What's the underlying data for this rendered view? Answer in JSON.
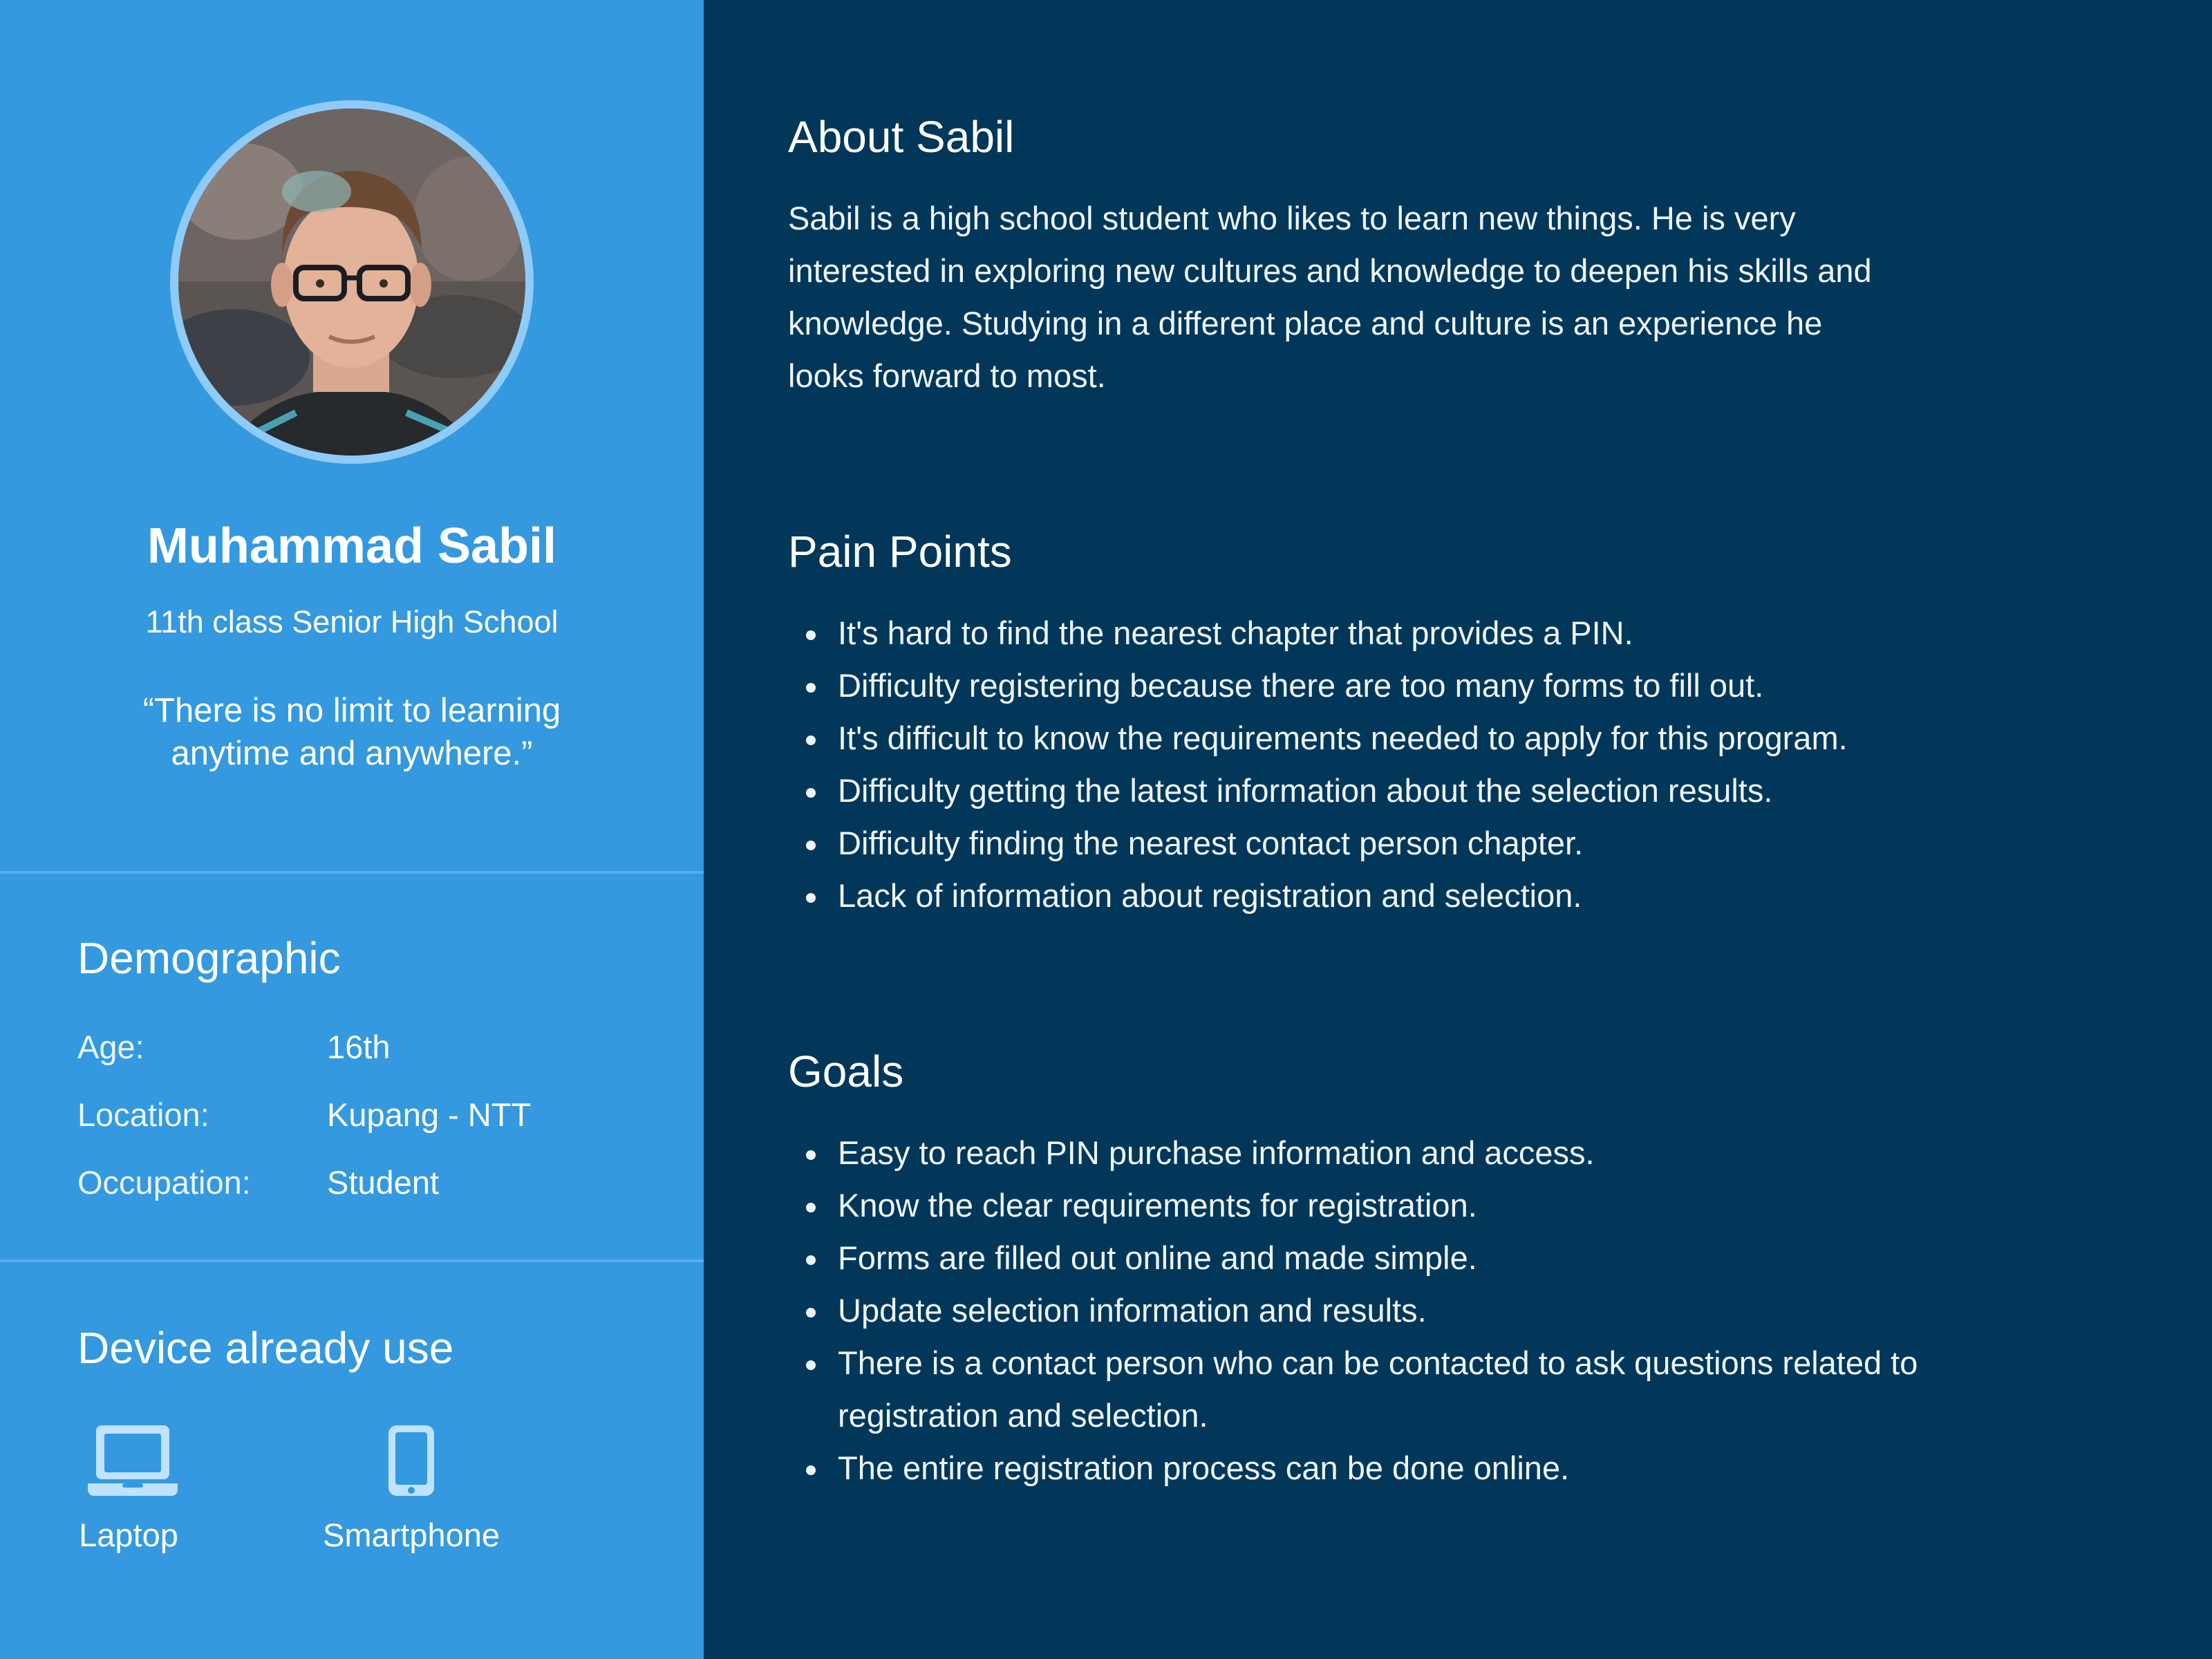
{
  "profile": {
    "name": "Muhammad Sabil",
    "subtitle": "11th class Senior High School",
    "quote_line1": "“There is no limit to learning",
    "quote_line2": "anytime and anywhere.”"
  },
  "demographic": {
    "title": "Demographic",
    "rows": [
      {
        "label": "Age:",
        "value": "16th"
      },
      {
        "label": "Location:",
        "value": "Kupang - NTT"
      },
      {
        "label": "Occupation:",
        "value": "Student"
      }
    ]
  },
  "devices": {
    "title": "Device already use",
    "items": [
      {
        "label": "Laptop",
        "icon": "laptop-icon"
      },
      {
        "label": "Smartphone",
        "icon": "smartphone-icon"
      }
    ]
  },
  "about": {
    "title": "About Sabil",
    "lines": [
      "Sabil is a high school student who likes to learn new things. He is very",
      "interested in exploring new cultures and knowledge to deepen his skills and",
      "knowledge. Studying in a different place and culture is an experience he",
      "looks forward to most."
    ]
  },
  "pain_points": {
    "title": "Pain Points",
    "items": [
      "It's hard to find the nearest chapter that provides a PIN.",
      "Difficulty registering because there are too many forms to fill out.",
      "It's difficult to know the requirements needed to apply for this program.",
      "Difficulty getting the latest information about the selection results.",
      "Difficulty finding the nearest contact person chapter.",
      "Lack of information about registration and selection."
    ]
  },
  "goals": {
    "title": "Goals",
    "items": [
      "Easy to reach PIN purchase information and access.",
      "Know the clear requirements for registration.",
      "Forms are filled out online and made simple.",
      "Update selection information and results.",
      "There is a contact person who can be contacted to ask questions related to",
      "registration and selection.",
      "The entire registration process can be done online."
    ]
  },
  "colors": {
    "left_panel": "#3499df",
    "right_panel": "#02375a",
    "avatar_ring": "#8fcbf8",
    "icon_color": "#bfe3ff"
  }
}
